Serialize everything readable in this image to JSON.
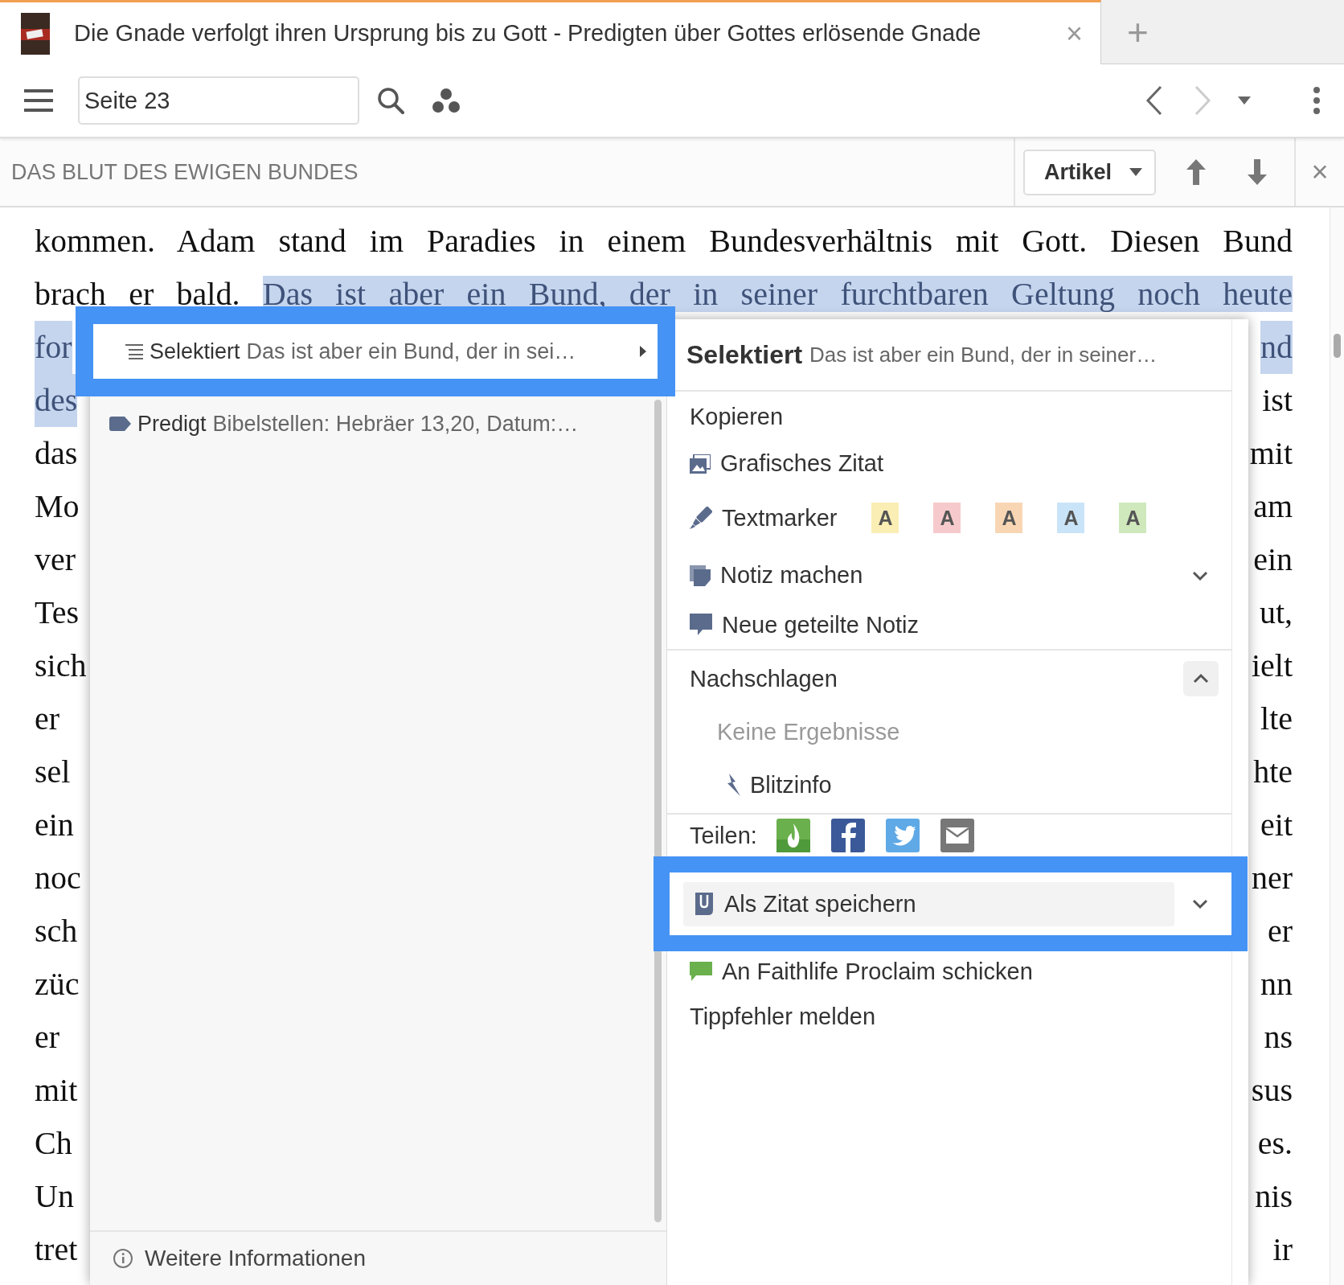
{
  "tab": {
    "title": "Die Gnade verfolgt ihren Ursprung bis zu Gott - Predigten über Gottes erlösende Gnade",
    "close": "×",
    "new_tab": "+"
  },
  "toolbar": {
    "page_field": "Seite 23",
    "back_disabled": false,
    "forward_disabled": true
  },
  "article_bar": {
    "title": "DAS BLUT DES EWIGEN BUNDES",
    "dropdown": "Artikel",
    "close": "×"
  },
  "text": {
    "lines": [
      {
        "kind": "full",
        "segments": [
          {
            "text": "kommen. Adam stand im Paradies in einem Bundesverhältnis mit Gott. Diesen Bund",
            "selected": false
          }
        ]
      },
      {
        "kind": "full",
        "segments": [
          {
            "text": "brach er bald.",
            "selected": false
          },
          {
            "text": "Das ist aber ein Bund, der in seiner furchtbaren Geltung noch heute",
            "selected": true
          }
        ]
      },
      {
        "kind": "split",
        "segments": [
          {
            "text": "for",
            "selected": true
          },
          {
            "text": "nd",
            "selected": true
          }
        ]
      },
      {
        "kind": "split",
        "segments": [
          {
            "text": "des",
            "selected": true
          },
          {
            "text": "ist",
            "selected": false
          }
        ]
      },
      {
        "kind": "split",
        "segments": [
          {
            "text": "das",
            "selected": false
          },
          {
            "text": "mit",
            "selected": false
          }
        ]
      },
      {
        "kind": "split",
        "segments": [
          {
            "text": "Mo",
            "selected": false
          },
          {
            "text": "am",
            "selected": false
          }
        ]
      },
      {
        "kind": "split",
        "segments": [
          {
            "text": "ver",
            "selected": false
          },
          {
            "text": "ein",
            "selected": false
          }
        ]
      },
      {
        "kind": "split",
        "segments": [
          {
            "text": "Tes",
            "selected": false
          },
          {
            "text": "ut,",
            "selected": false
          }
        ]
      },
      {
        "kind": "split",
        "segments": [
          {
            "text": "sich",
            "selected": false
          },
          {
            "text": "ielt",
            "selected": false
          }
        ]
      },
      {
        "kind": "split",
        "segments": [
          {
            "text": "er",
            "selected": false
          },
          {
            "text": "lte",
            "selected": false
          }
        ]
      },
      {
        "kind": "split",
        "segments": [
          {
            "text": "sel",
            "selected": false
          },
          {
            "text": "hte",
            "selected": false
          }
        ]
      },
      {
        "kind": "split",
        "segments": [
          {
            "text": "ein",
            "selected": false
          },
          {
            "text": "eit",
            "selected": false
          }
        ]
      },
      {
        "kind": "split",
        "segments": [
          {
            "text": "noc",
            "selected": false
          },
          {
            "text": "ner",
            "selected": false
          }
        ]
      },
      {
        "kind": "split",
        "segments": [
          {
            "text": "sch",
            "selected": false
          },
          {
            "text": "er",
            "selected": false
          }
        ]
      },
      {
        "kind": "split",
        "segments": [
          {
            "text": "züc",
            "selected": false
          },
          {
            "text": "nn",
            "selected": false
          }
        ]
      },
      {
        "kind": "split",
        "segments": [
          {
            "text": "er",
            "selected": false
          },
          {
            "text": "ns",
            "selected": false
          }
        ]
      },
      {
        "kind": "split",
        "segments": [
          {
            "text": "mit",
            "selected": false
          },
          {
            "text": "sus",
            "selected": false
          }
        ]
      },
      {
        "kind": "split",
        "segments": [
          {
            "text": "Ch",
            "selected": false
          },
          {
            "text": "es.",
            "selected": false
          }
        ]
      },
      {
        "kind": "split",
        "segments": [
          {
            "text": "Un",
            "selected": false
          },
          {
            "text": "nis",
            "selected": false
          }
        ]
      },
      {
        "kind": "split",
        "segments": [
          {
            "text": "tret",
            "selected": false
          },
          {
            "text": "ir",
            "selected": false
          }
        ]
      }
    ]
  },
  "popup": {
    "sidebar": {
      "items": [
        {
          "kind": "selection",
          "label": "Selektiert",
          "text": "Das ist aber ein Bund, der in sei…",
          "selected": true
        },
        {
          "kind": "tag",
          "label": "Predigt",
          "text": "Bibelstellen: Hebräer 13,20, Datum:…",
          "selected": false
        }
      ],
      "footer": "Weitere Informationen"
    },
    "menu": {
      "header": {
        "label": "Selektiert",
        "text": "Das ist aber ein Bund, der in seiner…"
      },
      "sections": [
        {
          "items": [
            {
              "kind": "copy",
              "label": "Kopieren",
              "highlighted": false
            },
            {
              "kind": "image-quote",
              "label": "Grafisches Zitat",
              "highlighted": false
            },
            {
              "kind": "highlighter",
              "label": "Textmarker",
              "highlighted": false,
              "swatches": [
                {
                  "label": "A",
                  "color": "#fbeeb4"
                },
                {
                  "label": "A",
                  "color": "#f6cacc"
                },
                {
                  "label": "A",
                  "color": "#f8d6b4"
                },
                {
                  "label": "A",
                  "color": "#c9e4f8"
                },
                {
                  "label": "A",
                  "color": "#cfe8bc"
                }
              ]
            },
            {
              "kind": "note",
              "label": "Notiz machen",
              "expanded": false,
              "highlighted": false
            },
            {
              "kind": "shared-note",
              "label": "Neue geteilte Notiz",
              "highlighted": false
            }
          ]
        },
        {
          "items": [
            {
              "kind": "lookup",
              "label": "Nachschlagen",
              "expanded": true,
              "highlighted": false
            },
            {
              "kind": "empty",
              "label": "Keine Ergebnisse",
              "highlighted": false
            },
            {
              "kind": "quick-info",
              "label": "Blitzinfo",
              "highlighted": false
            }
          ]
        },
        {
          "items": [
            {
              "kind": "share",
              "label": "Teilen:",
              "highlighted": false
            },
            {
              "kind": "save-quote",
              "label": "Als Zitat speichern",
              "expanded": false,
              "highlighted": true
            },
            {
              "kind": "proclaim",
              "label": "An Faithlife Proclaim schicken",
              "highlighted": false
            },
            {
              "kind": "typo",
              "label": "Tippfehler melden",
              "highlighted": false
            }
          ]
        }
      ]
    }
  }
}
